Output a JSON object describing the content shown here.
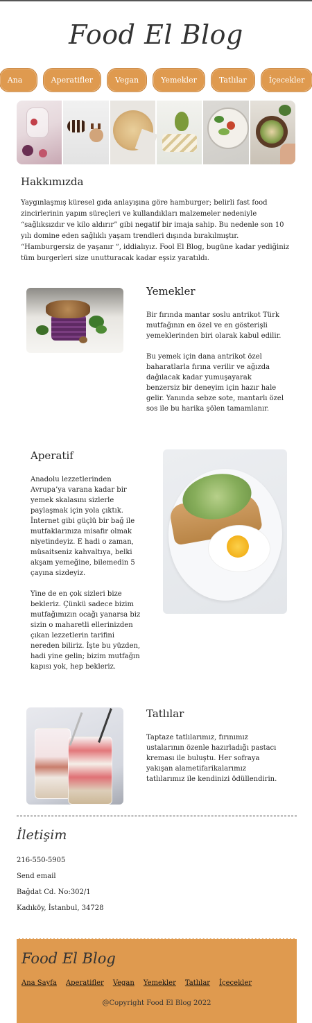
{
  "header": {
    "logo": "Food El Blog"
  },
  "nav": {
    "items": [
      "Ana Sayfa",
      "Aperatifler",
      "Vegan",
      "Yemekler",
      "Tatlılar",
      "İçecekler"
    ]
  },
  "about": {
    "title": "Hakkımızda",
    "text": "Yaygınlaşmış küresel gıda anlayışına göre hamburger; belirli fast food zincirlerinin yapım süreçleri ve kullandıkları malzemeler nedeniyle “sağlıksızdır ve kilo aldırır” gibi negatif bir imaja sahip. Bu nedenle son 10 yılı domine eden sağlıklı yaşam trendleri dışında bırakılmıştır. “Hamburgersiz de yaşanır “, iddialıyız. Fool El Blog, bugüne kadar yediğiniz tüm burgerleri size unutturacak kadar eşsiz yaratıldı."
  },
  "sections": {
    "food": {
      "title": "Yemekler",
      "p1": "Bir fırında mantar soslu antrikot Türk mutfağının en özel ve en gösterişli yemeklerinden biri olarak kabul edilir.",
      "p2": "Bu yemek için dana antrikot özel baharatlarla fırına verilir ve ağızda dağılacak kadar yumuşayarak benzersiz bir deneyim için hazır hale gelir. Yanında sebze sote, mantarlı özel sos ile bu harika şölen tamamlanır."
    },
    "appetizer": {
      "title": "Aperatif",
      "p1": "Anadolu lezzetlerinden Avrupa’ya varana kadar bir yemek skalasını sizlerle paylaşmak için yola çıktık. İnternet gibi güçlü bir bağ ile mutfaklarınıza misafir olmak niyetindeyiz. E hadi o zaman, müsaitseniz kahvaltıya, belki akşam yemeğine, bilemedin 5 çayına sizdeyiz.",
      "p2": "Yine de en çok sizleri bize bekleriz. Çünkü sadece bizim mutfağımızın ocağı yanarsa biz sizin o maharetli ellerinizden çıkan lezzetlerin tarifini nereden biliriz. İşte bu yüzden, hadi yine gelin; bizim mutfağın kapısı yok, hep bekleriz."
    },
    "dessert": {
      "title": "Tatlılar",
      "p1": "Taptaze tatlılarımız, fırınımız ustalarının özenle hazırladığı pastacı kreması ile buluştu. Her sofraya yakışan alametifarikalarımız tatlılarımız ile kendinizi ödüllendirin."
    }
  },
  "contact": {
    "title": "İletişim",
    "phone": "216-550-5905",
    "email": "Send email",
    "address1": "Bağdat Cd. No:302/1",
    "address2": "Kadıköy, İstanbul, 34728"
  },
  "footer": {
    "logo": "Food El Blog",
    "links": [
      "Ana Sayfa",
      "Aperatifler",
      "Vegan",
      "Yemekler",
      "Tatlılar",
      "İçecekler"
    ],
    "copyright": "@Copyright Food El Blog 2022"
  },
  "colors": {
    "accent": "#df9a4f"
  }
}
